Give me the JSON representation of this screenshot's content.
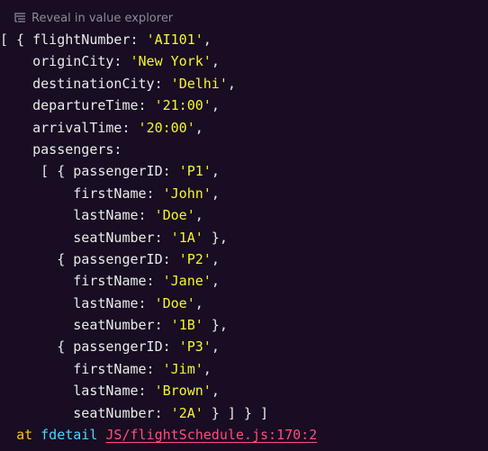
{
  "reveal": {
    "label": "Reveal in value explorer",
    "icon": "list-filter-icon"
  },
  "flight": {
    "flightNumber": "AI101",
    "originCity": "New York",
    "destinationCity": "Delhi",
    "departureTime": "21:00",
    "arrivalTime": "20:00"
  },
  "passengers": [
    {
      "passengerID": "P1",
      "firstName": "John",
      "lastName": "Doe",
      "seatNumber": "1A"
    },
    {
      "passengerID": "P2",
      "firstName": "Jane",
      "lastName": "Doe",
      "seatNumber": "1B"
    },
    {
      "passengerID": "P3",
      "firstName": "Jim",
      "lastName": "Brown",
      "seatNumber": "2A"
    }
  ],
  "stack": {
    "at": "at",
    "function": "fdetail",
    "location": "JS/flightSchedule.js:170:2"
  },
  "colors": {
    "background": "#180d22",
    "string": "#f5f52d",
    "key": "#e9e9e9",
    "at": "#f5c518",
    "function": "#48d7ff",
    "link": "#ff4d7a"
  }
}
